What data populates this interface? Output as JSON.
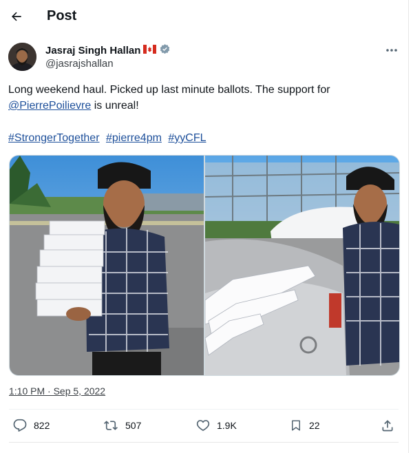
{
  "header": {
    "title": "Post"
  },
  "author": {
    "name": "Jasraj Singh Hallan",
    "handle": "@jasrajshallan",
    "flag": "canada-flag",
    "verified": true
  },
  "tweet": {
    "line1": "Long weekend haul. Picked up last minute ballots. The support for",
    "mention": "@PierrePoilievre",
    "line2_rest": " is unreal!",
    "hashtags": [
      "#StrongerTogether",
      "#pierre4pm",
      "#yyCFL"
    ]
  },
  "media": {
    "images": [
      {
        "name": "man-holding-ballot-stacks-photo"
      },
      {
        "name": "ballots-on-car-trunk-photo"
      }
    ]
  },
  "timestamp": "1:10 PM · Sep 5, 2022",
  "stats": {
    "replies": "822",
    "reposts": "507",
    "likes": "1.9K",
    "bookmarks": "22"
  },
  "colors": {
    "link": "#1d4f9a",
    "verified": "#829aab",
    "text": "#0f1419"
  }
}
